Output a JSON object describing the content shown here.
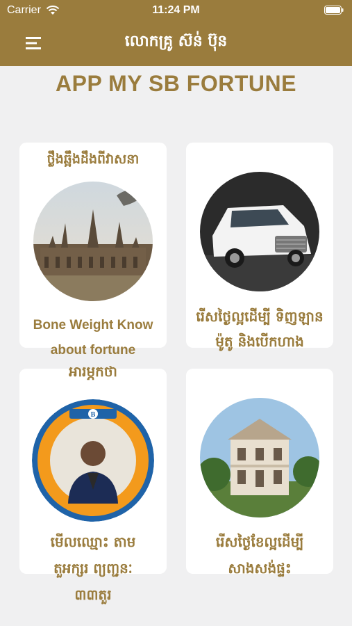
{
  "status_bar": {
    "carrier": "Carrier",
    "time": "11:24 PM"
  },
  "header": {
    "title": "លោកគ្រូ ស៊ន់ ប៊ុន"
  },
  "app_title": "APP MY SB FORTUNE",
  "cards": [
    {
      "label": "ថ្លឹងឆ្អឹងដឹងពីវាសនា",
      "sublabel_en": "Bone Weight Know about fortune",
      "image": "angkor-wat-image"
    },
    {
      "label": "រើសថ្ងៃល្អដើម្បី ទិញឡាន ម៉ូតូ និងបើកហាង",
      "image": "white-suv-image"
    },
    {
      "label": "អារម្ភកថា",
      "image": "astrologer-logo-image",
      "logo_text": "លោកគ្រូ B ស៊ន់ ប៊ុន"
    },
    {
      "label": "មើលឈ្មោះ តាមតួអក្សរ ព្យញ្ជនៈ ៣៣តួរ",
      "label_lines": [
        "មើលឈ្មោះ តាម",
        "តួអក្សរ ព្យញ្ជនៈ",
        "៣៣តួរ"
      ]
    },
    {
      "label": "រើសថ្ងៃខែល្អដើម្បី សាងសង់ផ្ទះ",
      "image": "villa-house-image",
      "label_lines": [
        "រើសថ្ងៃខែល្អដើម្បី",
        "សាងសង់ផ្ទះ"
      ]
    }
  ],
  "colors": {
    "header_bg": "#9a7c3d",
    "accent": "#9a7c3d",
    "page_bg": "#f0f0f1",
    "card_bg": "#ffffff"
  }
}
